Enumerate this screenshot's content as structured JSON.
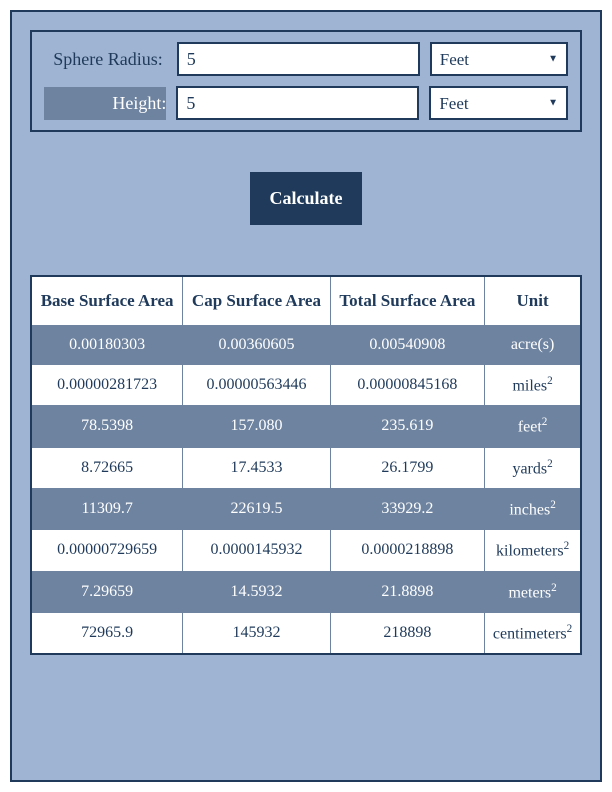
{
  "inputs": {
    "radius_label": "Sphere Radius:",
    "radius_value": "5",
    "radius_unit": "Feet",
    "height_label": "Height:",
    "height_value": "5",
    "height_unit": "Feet"
  },
  "button": {
    "calculate_label": "Calculate"
  },
  "table": {
    "headers": {
      "base": "Base Surface Area",
      "cap": "Cap Surface Area",
      "total": "Total Surface Area",
      "unit": "Unit"
    },
    "rows": [
      {
        "base": "0.00180303",
        "cap": "0.00360605",
        "total": "0.00540908",
        "unit": "acre(s)",
        "unit_sup": ""
      },
      {
        "base": "0.00000281723",
        "cap": "0.00000563446",
        "total": "0.00000845168",
        "unit": "miles",
        "unit_sup": "2"
      },
      {
        "base": "78.5398",
        "cap": "157.080",
        "total": "235.619",
        "unit": "feet",
        "unit_sup": "2"
      },
      {
        "base": "8.72665",
        "cap": "17.4533",
        "total": "26.1799",
        "unit": "yards",
        "unit_sup": "2"
      },
      {
        "base": "11309.7",
        "cap": "22619.5",
        "total": "33929.2",
        "unit": "inches",
        "unit_sup": "2"
      },
      {
        "base": "0.00000729659",
        "cap": "0.0000145932",
        "total": "0.0000218898",
        "unit": "kilometers",
        "unit_sup": "2"
      },
      {
        "base": "7.29659",
        "cap": "14.5932",
        "total": "21.8898",
        "unit": "meters",
        "unit_sup": "2"
      },
      {
        "base": "72965.9",
        "cap": "145932",
        "total": "218898",
        "unit": "centimeters",
        "unit_sup": "2"
      }
    ]
  }
}
